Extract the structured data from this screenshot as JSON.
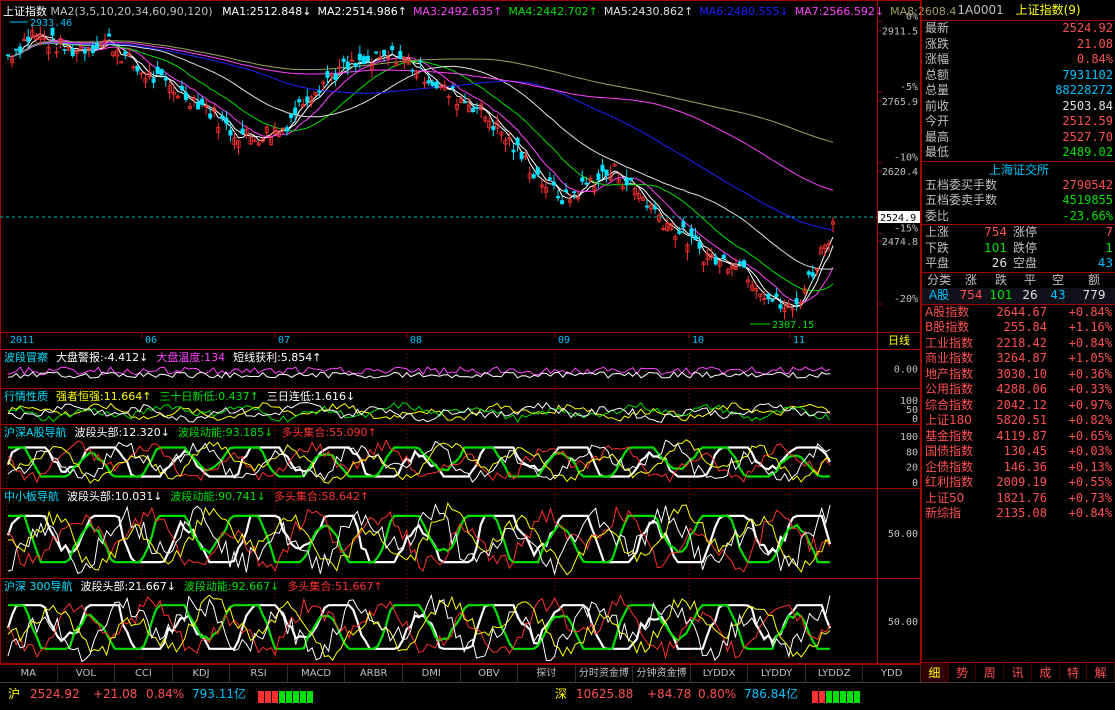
{
  "main_chart": {
    "index_name": "上证指数",
    "ma_params": "MA2(3,5,10,20,34,60,90,120)",
    "ma": [
      {
        "label": "MA1:2512.848↓",
        "color": "#ffffff"
      },
      {
        "label": "MA2:2514.986↑",
        "color": "#ffffff"
      },
      {
        "label": "MA3:2492.635↑",
        "color": "#ff40ff"
      },
      {
        "label": "MA4:2442.702↑",
        "color": "#00e000"
      },
      {
        "label": "MA5:2430.862↑",
        "color": "#e0e0e0"
      },
      {
        "label": "MA6:2480.555↓",
        "color": "#2020ff"
      },
      {
        "label": "MA7:2566.592↓",
        "color": "#ff40ff"
      },
      {
        "label": "MA8:2608.4",
        "color": "#a0a060"
      }
    ],
    "high_label": "2933.46",
    "low_label": "2307.15",
    "current_price_tag": "2524.9",
    "price_axis": [
      "2911.5",
      "2765.9",
      "2620.4",
      "2474.8"
    ],
    "pct_axis": [
      "0%",
      "-5%",
      "-10%",
      "-15%",
      "-20%"
    ],
    "date_labels": [
      "2011",
      "06",
      "07",
      "08",
      "09",
      "10",
      "11"
    ],
    "period": "日线"
  },
  "indicators": [
    {
      "title": "波段冒察",
      "items": [
        {
          "t": "大盘警报:-4.412↓",
          "c": "#ffffff"
        },
        {
          "t": "大盘温度:134",
          "c": "#ff40ff"
        },
        {
          "t": "短线获利:5.854↑",
          "c": "#ffffff"
        }
      ],
      "axis": [
        "0.00"
      ]
    },
    {
      "title": "行情性质",
      "items": [
        {
          "t": "强者恒强:11.664↑",
          "c": "#ffff00"
        },
        {
          "t": "三十日新低:0.437↑",
          "c": "#00e000"
        },
        {
          "t": "三日连低:1.616↓",
          "c": "#ffffff"
        }
      ],
      "axis": [
        "100",
        "50",
        "0"
      ]
    },
    {
      "title": "沪深A股导航",
      "items": [
        {
          "t": "波段头部:12.320↓",
          "c": "#ffffff"
        },
        {
          "t": "波段动能:93.185↓",
          "c": "#00e000"
        },
        {
          "t": "多头集合:55.090↑",
          "c": "#ff3030"
        }
      ],
      "axis": [
        "100",
        "80",
        "20",
        "0"
      ]
    },
    {
      "title": "中小板导航",
      "items": [
        {
          "t": "波段头部:10.031↓",
          "c": "#ffffff"
        },
        {
          "t": "波段动能:90.741↓",
          "c": "#00e000"
        },
        {
          "t": "多头集合:58.642↑",
          "c": "#ff3030"
        }
      ],
      "axis": [
        "50.00"
      ]
    },
    {
      "title": "沪深 300导航",
      "items": [
        {
          "t": "波段头部:21.667↓",
          "c": "#ffffff"
        },
        {
          "t": "波段动能:92.667↓",
          "c": "#00e000"
        },
        {
          "t": "多头集合:51.667↑",
          "c": "#ff3030"
        }
      ],
      "axis": [
        "50.00"
      ]
    }
  ],
  "bottom_tabs": [
    "MA",
    "VOL",
    "CCI",
    "KDJ",
    "RSI",
    "MACD",
    "ARBR",
    "DMI",
    "OBV",
    "探讨",
    "分时资金博",
    "分钟资金博",
    "LYDDX",
    "LYDDY",
    "LYDDZ",
    "YDD"
  ],
  "right_panel": {
    "code": "1A0001",
    "name": "上证指数(9)",
    "quote": [
      {
        "l": "最新",
        "v": "2524.92",
        "c": "red"
      },
      {
        "l": "涨跌",
        "v": "21.08",
        "c": "red"
      },
      {
        "l": "涨幅",
        "v": "0.84%",
        "c": "red"
      },
      {
        "l": "总额",
        "v": "7931102",
        "c": "cyan"
      },
      {
        "l": "总量",
        "v": "88228272",
        "c": "cyan"
      },
      {
        "l": "前收",
        "v": "2503.84",
        "c": "white"
      },
      {
        "l": "今开",
        "v": "2512.59",
        "c": "red"
      },
      {
        "l": "最高",
        "v": "2527.70",
        "c": "red"
      },
      {
        "l": "最低",
        "v": "2489.02",
        "c": "green"
      }
    ],
    "exchange": "上海证交所",
    "bidask": [
      {
        "l": "五档委买手数",
        "v": "2790542",
        "c": "red"
      },
      {
        "l": "五档委卖手数",
        "v": "4519855",
        "c": "green"
      },
      {
        "l": "委比",
        "v": "-23.66%",
        "c": "green"
      }
    ],
    "breadth": [
      {
        "a": "上涨",
        "av": "754",
        "ac": "red",
        "b": "涨停",
        "bv": "7",
        "bc": "red"
      },
      {
        "a": "下跌",
        "av": "101",
        "ac": "green",
        "b": "跌停",
        "bv": "1",
        "bc": "green"
      },
      {
        "a": "平盘",
        "av": "26",
        "ac": "white",
        "b": "空盘",
        "bv": "43",
        "bc": "cyan"
      }
    ],
    "class_header": [
      "分类",
      "涨",
      "跌",
      "平",
      "空",
      "额"
    ],
    "class_row": [
      "A股",
      "754",
      "101",
      "26",
      "43",
      "779"
    ],
    "indices": [
      {
        "n": "A股指数",
        "v": "2644.67",
        "p": "+0.84%"
      },
      {
        "n": "B股指数",
        "v": "255.84",
        "p": "+1.16%"
      },
      {
        "n": "工业指数",
        "v": "2218.42",
        "p": "+0.84%"
      },
      {
        "n": "商业指数",
        "v": "3264.87",
        "p": "+1.05%"
      },
      {
        "n": "地产指数",
        "v": "3030.10",
        "p": "+0.36%"
      },
      {
        "n": "公用指数",
        "v": "4288.06",
        "p": "+0.33%"
      },
      {
        "n": "综合指数",
        "v": "2042.12",
        "p": "+0.97%"
      },
      {
        "n": "上证180",
        "v": "5820.51",
        "p": "+0.82%"
      },
      {
        "n": "基金指数",
        "v": "4119.87",
        "p": "+0.65%"
      },
      {
        "n": "国债指数",
        "v": "130.45",
        "p": "+0.03%"
      },
      {
        "n": "企债指数",
        "v": "146.36",
        "p": "+0.13%"
      },
      {
        "n": "红利指数",
        "v": "2009.19",
        "p": "+0.55%"
      },
      {
        "n": "上证50",
        "v": "1821.76",
        "p": "+0.73%"
      },
      {
        "n": "新综指",
        "v": "2135.08",
        "p": "+0.84%"
      }
    ],
    "tabs": [
      "细",
      "势",
      "周",
      "讯",
      "成",
      "特",
      "解"
    ]
  },
  "status_bar": {
    "sh_label": "沪",
    "sh_price": "2524.92",
    "sh_change": "+21.08",
    "sh_pct": "0.84%",
    "sh_amount": "793.11亿",
    "sz_label": "深",
    "sz_price": "10625.88",
    "sz_change": "+84.78",
    "sz_pct": "0.80%",
    "sz_amount": "786.84亿"
  }
}
